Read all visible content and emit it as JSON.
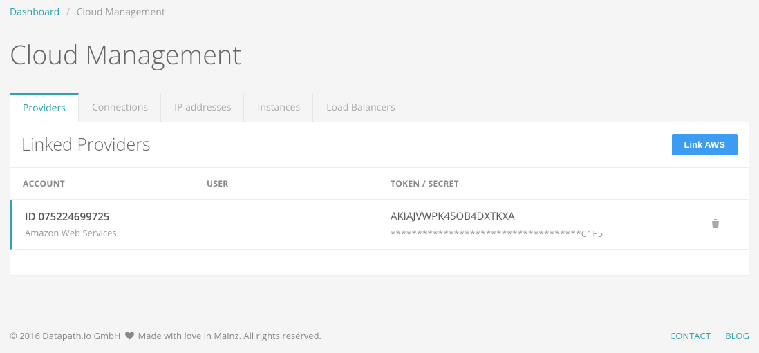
{
  "breadcrumb": {
    "root": "Dashboard",
    "current": "Cloud Management"
  },
  "page_title": "Cloud Management",
  "tabs": [
    {
      "label": "Providers",
      "active": true
    },
    {
      "label": "Connections",
      "active": false
    },
    {
      "label": "IP addresses",
      "active": false
    },
    {
      "label": "Instances",
      "active": false
    },
    {
      "label": "Load Balancers",
      "active": false
    }
  ],
  "panel": {
    "title": "Linked Providers",
    "action_label": "Link AWS",
    "columns": {
      "account": "ACCOUNT",
      "user": "USER",
      "token": "TOKEN / SECRET"
    },
    "rows": [
      {
        "account_id": "ID 075224699725",
        "account_name": "Amazon Web Services",
        "user": "",
        "token": "AKIAJVWPK45OB4DXTKXA",
        "secret": "************************************C1F5"
      }
    ]
  },
  "footer": {
    "copyright_prefix": "© 2016 Datapath.io GmbH ",
    "copyright_suffix": " Made with love in Mainz. All rights reserved.",
    "links": {
      "contact": "CONTACT",
      "blog": "BLOG"
    }
  }
}
